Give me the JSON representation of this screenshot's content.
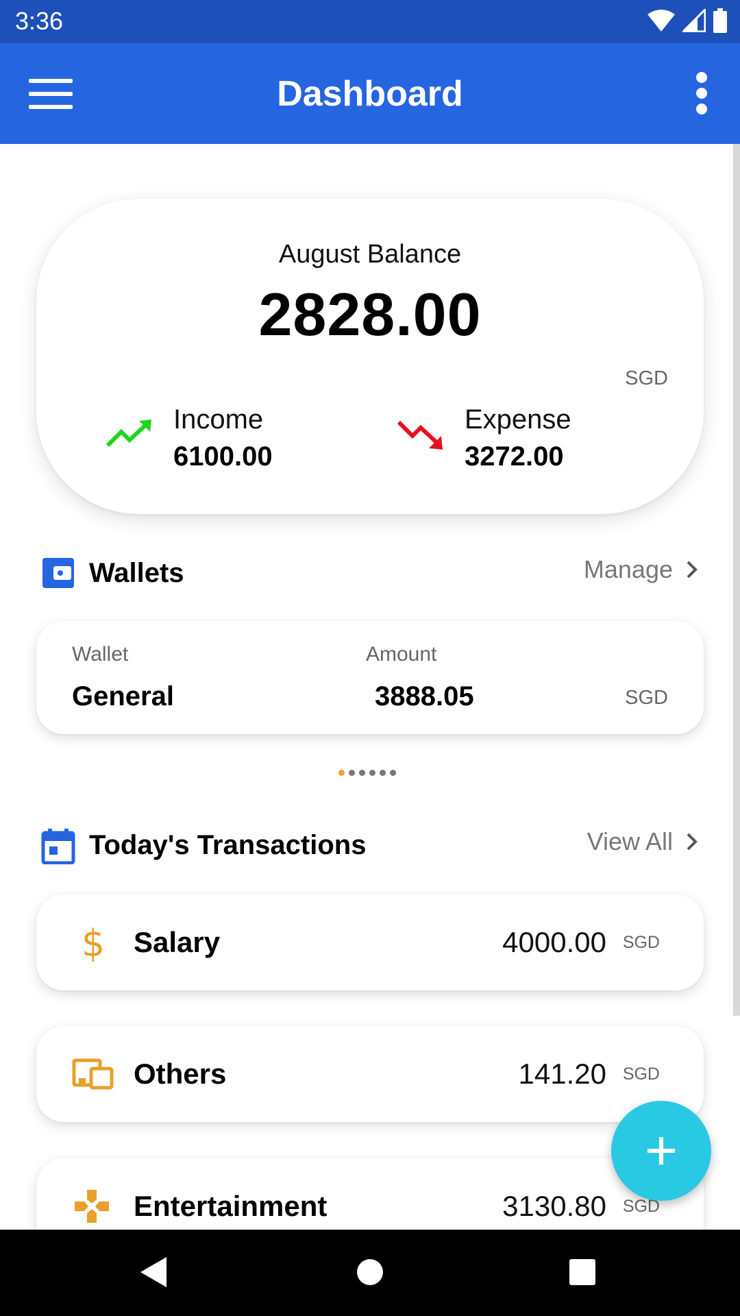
{
  "status_bar": {
    "time": "3:36"
  },
  "app_bar": {
    "title": "Dashboard"
  },
  "balance": {
    "label": "August Balance",
    "value": "2828.00",
    "currency": "SGD",
    "income_label": "Income",
    "income_value": "6100.00",
    "expense_label": "Expense",
    "expense_value": "3272.00"
  },
  "wallets": {
    "title": "Wallets",
    "link": "Manage",
    "wallet_col_label": "Wallet",
    "amount_col_label": "Amount",
    "name": "General",
    "amount": "3888.05",
    "currency": "SGD",
    "pages": 6,
    "active_page": 1
  },
  "transactions": {
    "title": "Today's Transactions",
    "link": "View All",
    "items": [
      {
        "name": "Salary",
        "amount": "4000.00",
        "currency": "SGD",
        "icon": "dollar-icon"
      },
      {
        "name": "Others",
        "amount": "141.20",
        "currency": "SGD",
        "icon": "devices-icon"
      },
      {
        "name": "Entertainment",
        "amount": "3130.80",
        "currency": "SGD",
        "icon": "gamepad-icon"
      }
    ]
  },
  "colors": {
    "status_bar": "#1d50b8",
    "app_bar": "#2565e0",
    "accent_orange": "#e8a02a",
    "income_green": "#1fd41f",
    "expense_red": "#e8101e",
    "fab": "#29c9e3"
  }
}
